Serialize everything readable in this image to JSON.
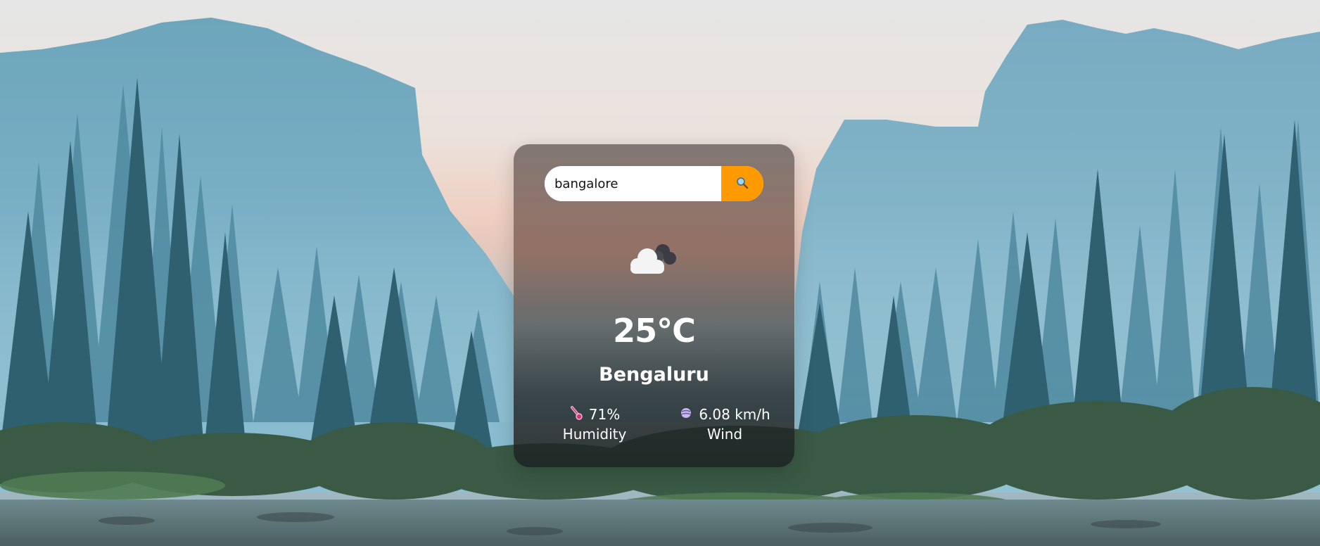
{
  "search": {
    "value": "bangalore",
    "button_icon": "search-icon"
  },
  "weather": {
    "icon": "cloud-icon",
    "temperature": "25°C",
    "city": "Bengaluru"
  },
  "humidity": {
    "icon": "thermometer-icon",
    "value": "71%",
    "label": "Humidity"
  },
  "wind": {
    "icon": "wind-icon",
    "value": "6.08 km/h",
    "label": "Wind"
  },
  "colors": {
    "accent": "#ff9a00",
    "text": "#ffffff"
  }
}
